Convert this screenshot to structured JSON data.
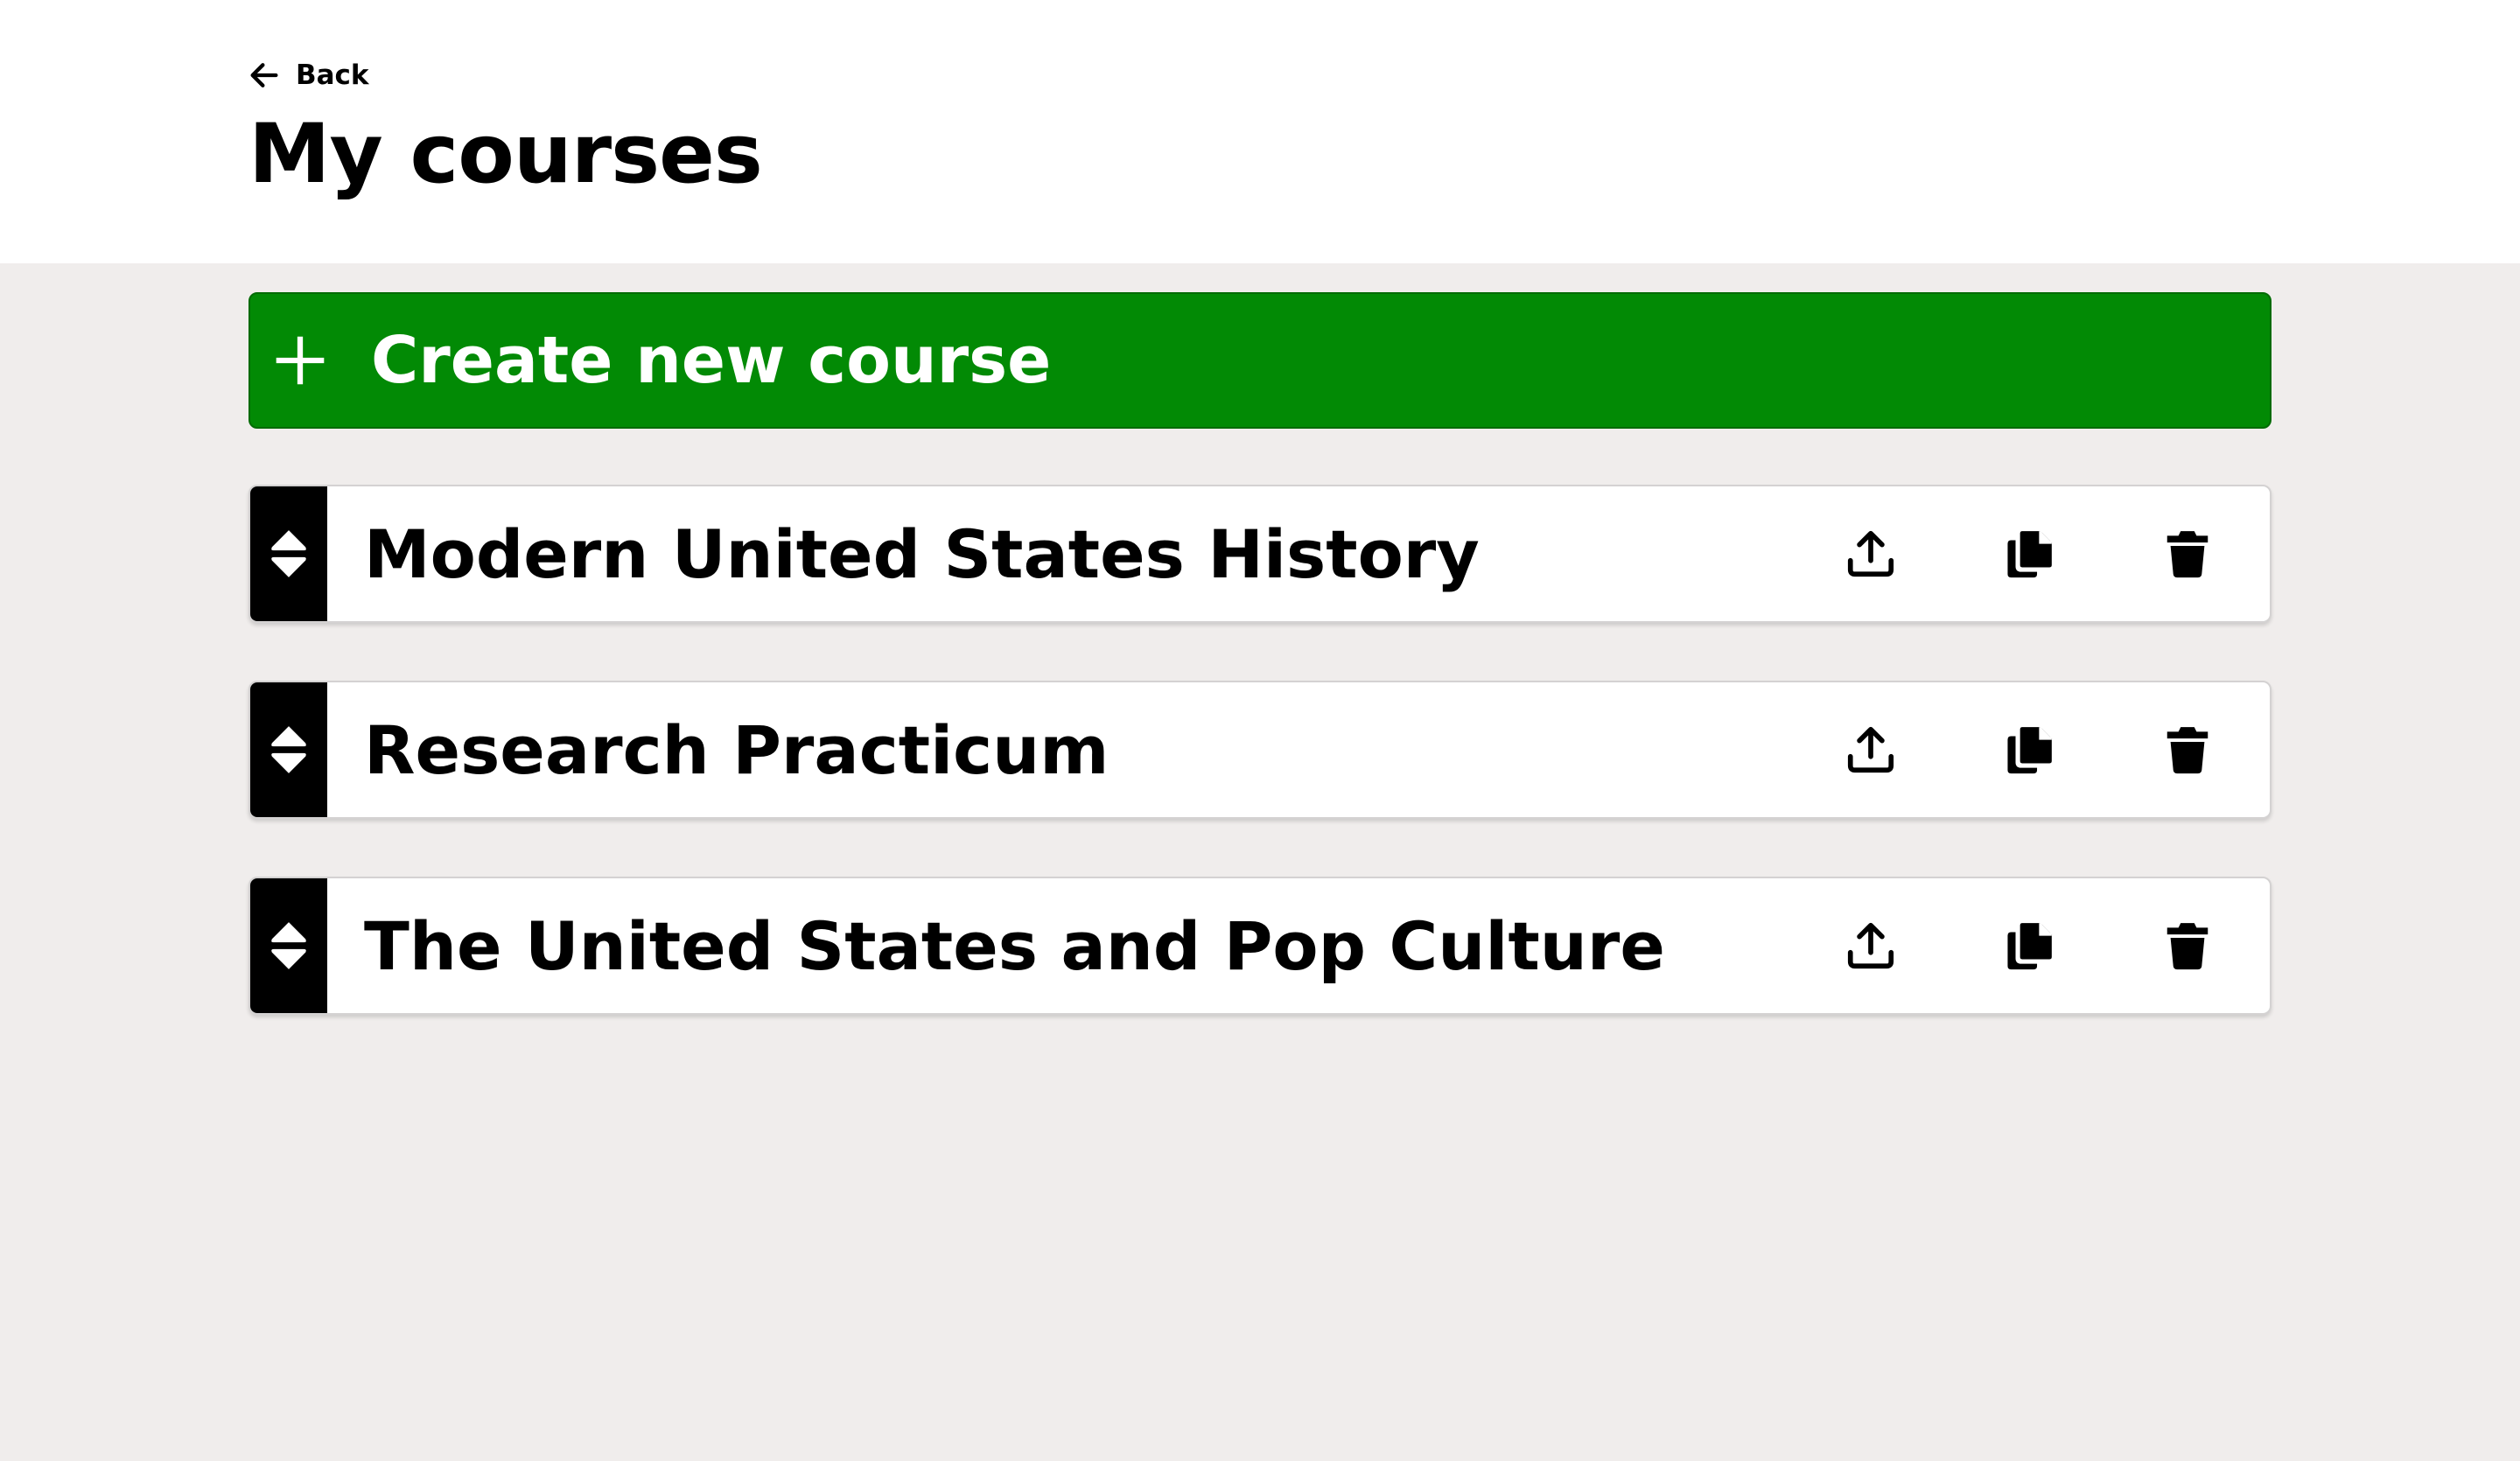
{
  "header": {
    "back_label": "Back",
    "title": "My courses"
  },
  "create_button": {
    "label": "Create new course",
    "icon": "plus-icon"
  },
  "courses": [
    {
      "title": "Modern United States History"
    },
    {
      "title": "Research Practicum"
    },
    {
      "title": "The United States and Pop Culture"
    }
  ],
  "row_actions": {
    "icons": [
      "drag-handle-icon",
      "export-icon",
      "copy-icon",
      "trash-icon"
    ]
  },
  "colors": {
    "accent_green": "#028a05",
    "page_background": "#f0edec",
    "handle": "#000000"
  }
}
